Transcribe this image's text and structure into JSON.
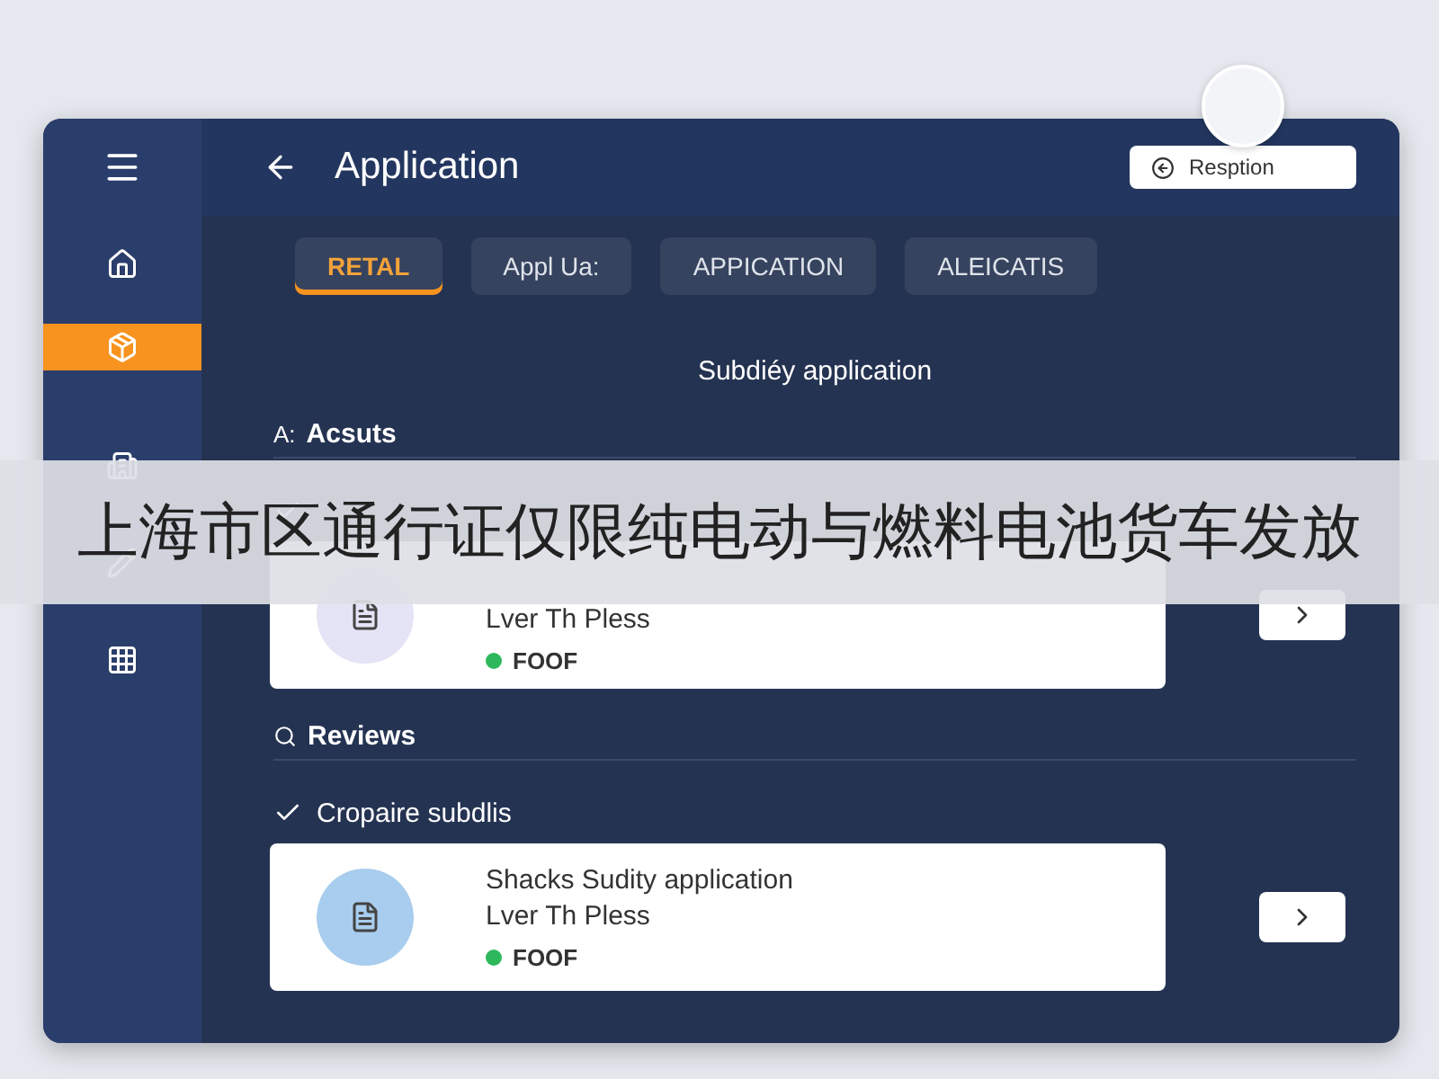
{
  "header": {
    "title": "Application",
    "action_button": {
      "label": "Resption"
    }
  },
  "sidebar": {
    "items": [
      {
        "selected": false
      },
      {
        "selected": true
      },
      {
        "selected": false
      },
      {
        "selected": false
      },
      {
        "selected": false
      }
    ]
  },
  "tabs": [
    {
      "label": "RETAL",
      "selected": true
    },
    {
      "label": "Appl Ua:",
      "selected": false
    },
    {
      "label": "APPICATION",
      "selected": false
    },
    {
      "label": "ALEICATIS",
      "selected": false
    }
  ],
  "page_title": "Subdiéy application",
  "sections": [
    {
      "prefix": "A:",
      "title": "Acsuts",
      "card": {
        "subtitle": "Lver Th Pless",
        "status": "FOOF",
        "color": "#e4e4f6"
      }
    },
    {
      "title": "Reviews",
      "check_label": "Cropaire subdlis",
      "card": {
        "title": "Shacks Sudity application",
        "subtitle": "Lver Th Pless",
        "status": "FOOF",
        "color": "#a8cdee"
      }
    }
  ],
  "banner": {
    "text": "上海市区通行证仅限纯电动与燃料电池货车发放"
  }
}
